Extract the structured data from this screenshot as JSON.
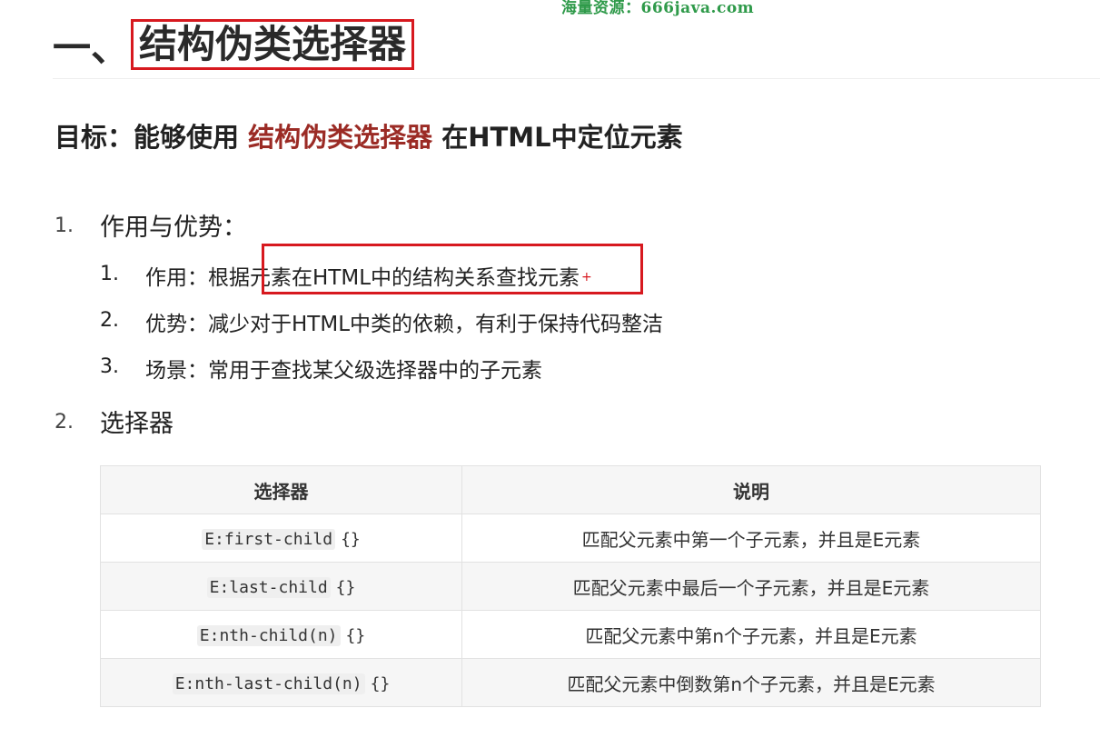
{
  "watermark": "海量资源：666java.com",
  "heading": {
    "prefix": "一、",
    "title": "结构伪类选择器"
  },
  "goal": {
    "before": "目标：能够使用",
    "accent": "结构伪类选择器",
    "after": "在HTML中定位元素"
  },
  "sections": [
    {
      "number": "1.",
      "title": "作用与优势：",
      "items": [
        {
          "number": "1.",
          "text": "作用：根据元素在HTML中的结构关系查找元素"
        },
        {
          "number": "2.",
          "text": "优势：减少对于HTML中类的依赖，有利于保持代码整洁"
        },
        {
          "number": "3.",
          "text": "场景：常用于查找某父级选择器中的子元素"
        }
      ]
    },
    {
      "number": "2.",
      "title": "选择器"
    }
  ],
  "table": {
    "headers": [
      "选择器",
      "说明"
    ],
    "rows": [
      {
        "selector": "E:first-child",
        "braces": "{}",
        "description": "匹配父元素中第一个子元素，并且是E元素"
      },
      {
        "selector": "E:last-child",
        "braces": "{}",
        "description": "匹配父元素中最后一个子元素，并且是E元素"
      },
      {
        "selector": "E:nth-child(n)",
        "braces": "{}",
        "description": "匹配父元素中第n个子元素，并且是E元素"
      },
      {
        "selector": "E:nth-last-child(n)",
        "braces": "{}",
        "description": "匹配父元素中倒数第n个子元素，并且是E元素"
      }
    ]
  },
  "colors": {
    "accent": "#9b2b25",
    "highlight_border": "#d7191f",
    "watermark": "#2f9a4a"
  }
}
